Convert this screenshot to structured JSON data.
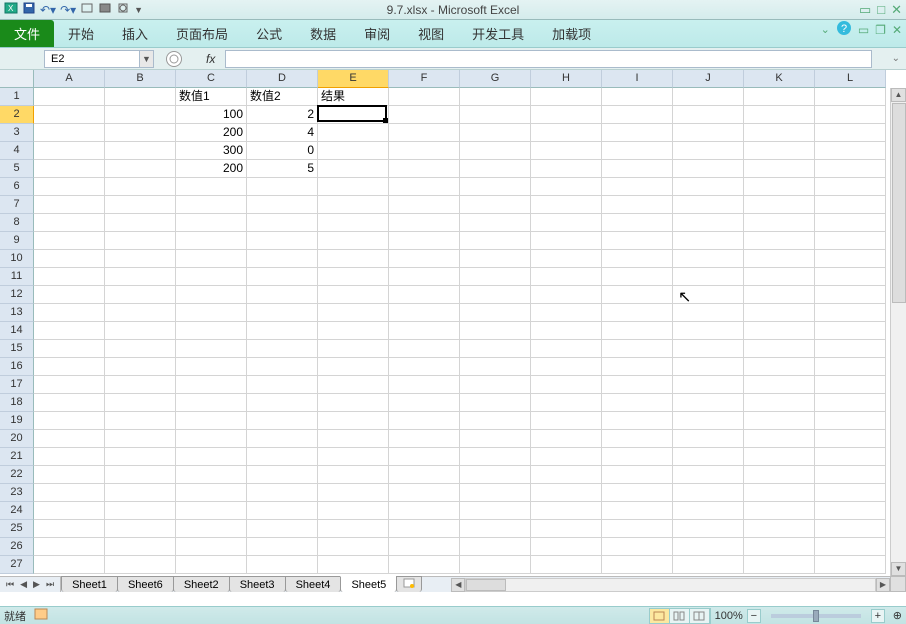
{
  "title": "9.7.xlsx - Microsoft Excel",
  "ribbon": {
    "file": "文件",
    "tabs": [
      "开始",
      "插入",
      "页面布局",
      "公式",
      "数据",
      "审阅",
      "视图",
      "开发工具",
      "加载项"
    ]
  },
  "namebox": "E2",
  "formula": "",
  "columns": [
    "A",
    "B",
    "C",
    "D",
    "E",
    "F",
    "G",
    "H",
    "I",
    "J",
    "K",
    "L"
  ],
  "active_col_index": 4,
  "rows": 27,
  "active_row": 2,
  "cells": {
    "r1": {
      "C": "数值1",
      "D": "数值2",
      "E": "结果"
    },
    "r2": {
      "C": "100",
      "D": "2"
    },
    "r3": {
      "C": "200",
      "D": "4"
    },
    "r4": {
      "C": "300",
      "D": "0"
    },
    "r5": {
      "C": "200",
      "D": "5"
    }
  },
  "sheets": [
    "Sheet1",
    "Sheet6",
    "Sheet2",
    "Sheet3",
    "Sheet4",
    "Sheet5"
  ],
  "active_sheet_index": 5,
  "status": {
    "ready": "就绪",
    "zoom": "100%"
  }
}
